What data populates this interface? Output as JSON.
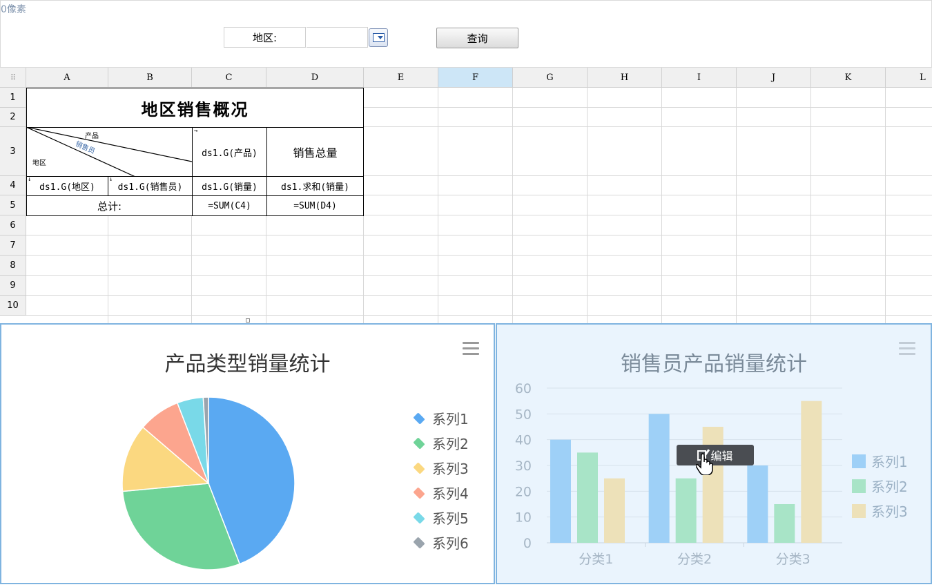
{
  "param_panel": {
    "pixel_note": "0像素",
    "region_label": "地区:",
    "region_value": "",
    "query_button": "查询"
  },
  "grid": {
    "columns": [
      "A",
      "B",
      "C",
      "D",
      "E",
      "F",
      "G",
      "H",
      "I",
      "J",
      "K",
      "L"
    ],
    "selected_column": "F",
    "rows": [
      "1",
      "2",
      "3",
      "4",
      "5",
      "6",
      "7",
      "8",
      "9",
      "10"
    ],
    "report": {
      "title": "地区销售概况",
      "diag_product": "产品",
      "diag_salesman": "销售员",
      "diag_region": "地区",
      "c3": "ds1.G(产品)",
      "d3": "销售总量",
      "a4": "ds1.G(地区)",
      "b4": "ds1.G(销售员)",
      "c4": "ds1.G(销量)",
      "d4": "ds1.求和(销量)",
      "a5": "总计:",
      "c5": "=SUM(C4)",
      "d5": "=SUM(D4)"
    }
  },
  "pie_chart": {
    "title": "产品类型销量统计",
    "menu_icon": "hamburger-menu-icon",
    "chart_data": {
      "type": "pie",
      "title": "产品类型销量统计",
      "series": [
        {
          "name": "系列1",
          "value": 45,
          "color": "#5aa9f2"
        },
        {
          "name": "系列2",
          "value": 30,
          "color": "#6fd398"
        },
        {
          "name": "系列3",
          "value": 13,
          "color": "#fbd880"
        },
        {
          "name": "系列4",
          "value": 8,
          "color": "#fca58e"
        },
        {
          "name": "系列5",
          "value": 5,
          "color": "#79d9e8"
        },
        {
          "name": "系列6",
          "value": 1,
          "color": "#9aa4ad"
        }
      ],
      "legend_position": "right"
    }
  },
  "bar_chart": {
    "title": "销售员产品销量统计",
    "menu_icon": "hamburger-menu-icon",
    "edit_tooltip": "编辑",
    "chart_data": {
      "type": "bar",
      "title": "销售员产品销量统计",
      "categories": [
        "分类1",
        "分类2",
        "分类3"
      ],
      "series": [
        {
          "name": "系列1",
          "values": [
            40,
            50,
            30
          ],
          "color": "#9ed0f7"
        },
        {
          "name": "系列2",
          "values": [
            35,
            25,
            15
          ],
          "color": "#a8e4c7"
        },
        {
          "name": "系列3",
          "values": [
            25,
            45,
            55
          ],
          "color": "#ede1b9"
        }
      ],
      "ylim": [
        0,
        60
      ],
      "yticks": [
        0,
        10,
        20,
        30,
        40,
        50,
        60
      ],
      "grid": true,
      "legend_position": "right"
    }
  }
}
